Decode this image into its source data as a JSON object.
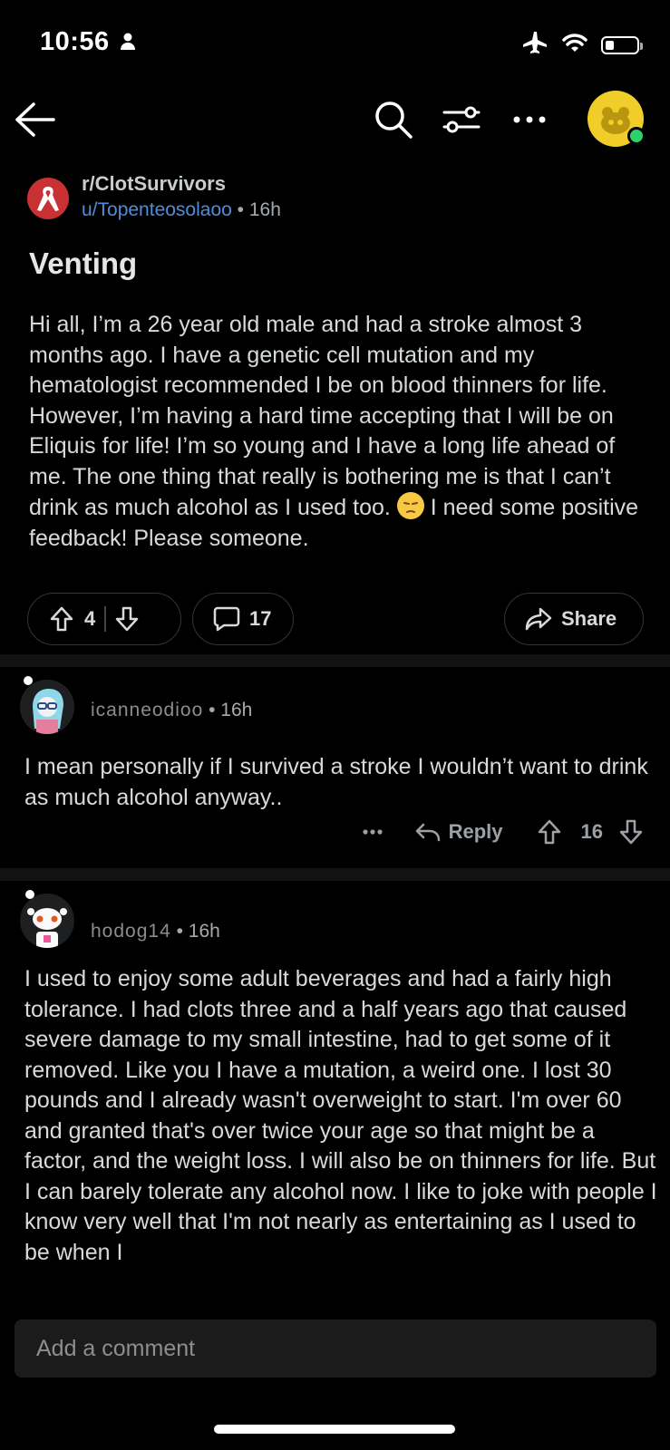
{
  "status_bar": {
    "time": "10:56"
  },
  "post": {
    "subreddit": "r/ClotSurvivors",
    "username": "u/Topenteosolaoo",
    "age": "16h",
    "title": "Venting",
    "body_before_emoji": "Hi all, I’m a 26 year old male and had a stroke almost 3 months ago. I have a genetic cell mutation and my hematologist recommended I be on blood thinners for life. However, I’m having a hard time accepting that I will be on Eliquis for life! I’m so young and I have a long life ahead of me. The one thing that really is bothering me is that I can’t drink as much alcohol as I used too.",
    "body_after_emoji": "I need some positive feedback! Please someone.",
    "votes": "4",
    "comments": "17",
    "share_label": "Share"
  },
  "comments": [
    {
      "username": "icanneodioo",
      "age": "16h",
      "body": "I mean personally if I survived a stroke I wouldn’t want to drink as much alcohol anyway..",
      "reply_label": "Reply",
      "votes": "16"
    },
    {
      "username": "hodog14",
      "age": "16h",
      "body": "I used to enjoy some adult beverages and had a fairly high tolerance. I had clots three and a half years ago that caused severe damage to my small intestine, had to get some of it removed. Like you I have a mutation, a weird one. I lost 30 pounds and I already wasn't overweight to start. I'm over 60 and granted that's over twice your age so that might be a factor, and the weight loss. I will also be on thinners for life. But I can barely tolerate any alcohol now. I like to joke with people I know very well that I'm not nearly as entertaining as I used to be when I"
    }
  ],
  "add_comment": {
    "placeholder": "Add a comment"
  },
  "colors": {
    "background": "#000000",
    "accent_blue": "#4f8ddb",
    "subreddit_red": "#c93134",
    "avatar_yellow": "#f1cd2a",
    "online_green": "#2bd46b"
  }
}
